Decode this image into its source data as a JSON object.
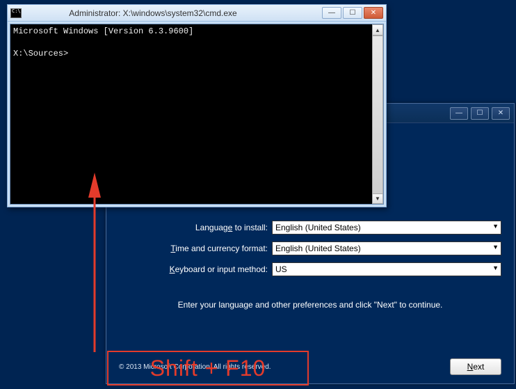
{
  "setup": {
    "labels": {
      "language": "Language to install:",
      "time": "Time and currency format:",
      "keyboard": "Keyboard or input method:"
    },
    "values": {
      "language": "English (United States)",
      "time": "English (United States)",
      "keyboard": "US"
    },
    "instruction": "Enter your language and other preferences and click \"Next\" to continue.",
    "copyright": "© 2013 Microsoft Corporation. All rights reserved.",
    "next_label": "Next"
  },
  "cmd": {
    "title": "Administrator: X:\\windows\\system32\\cmd.exe",
    "line1": "Microsoft Windows [Version 6.3.9600]",
    "prompt": "X:\\Sources>"
  },
  "annotation": {
    "text": "Shift + F10"
  },
  "icons": {
    "minimize": "—",
    "maximize": "☐",
    "close": "✕",
    "up": "▲",
    "down": "▼"
  }
}
